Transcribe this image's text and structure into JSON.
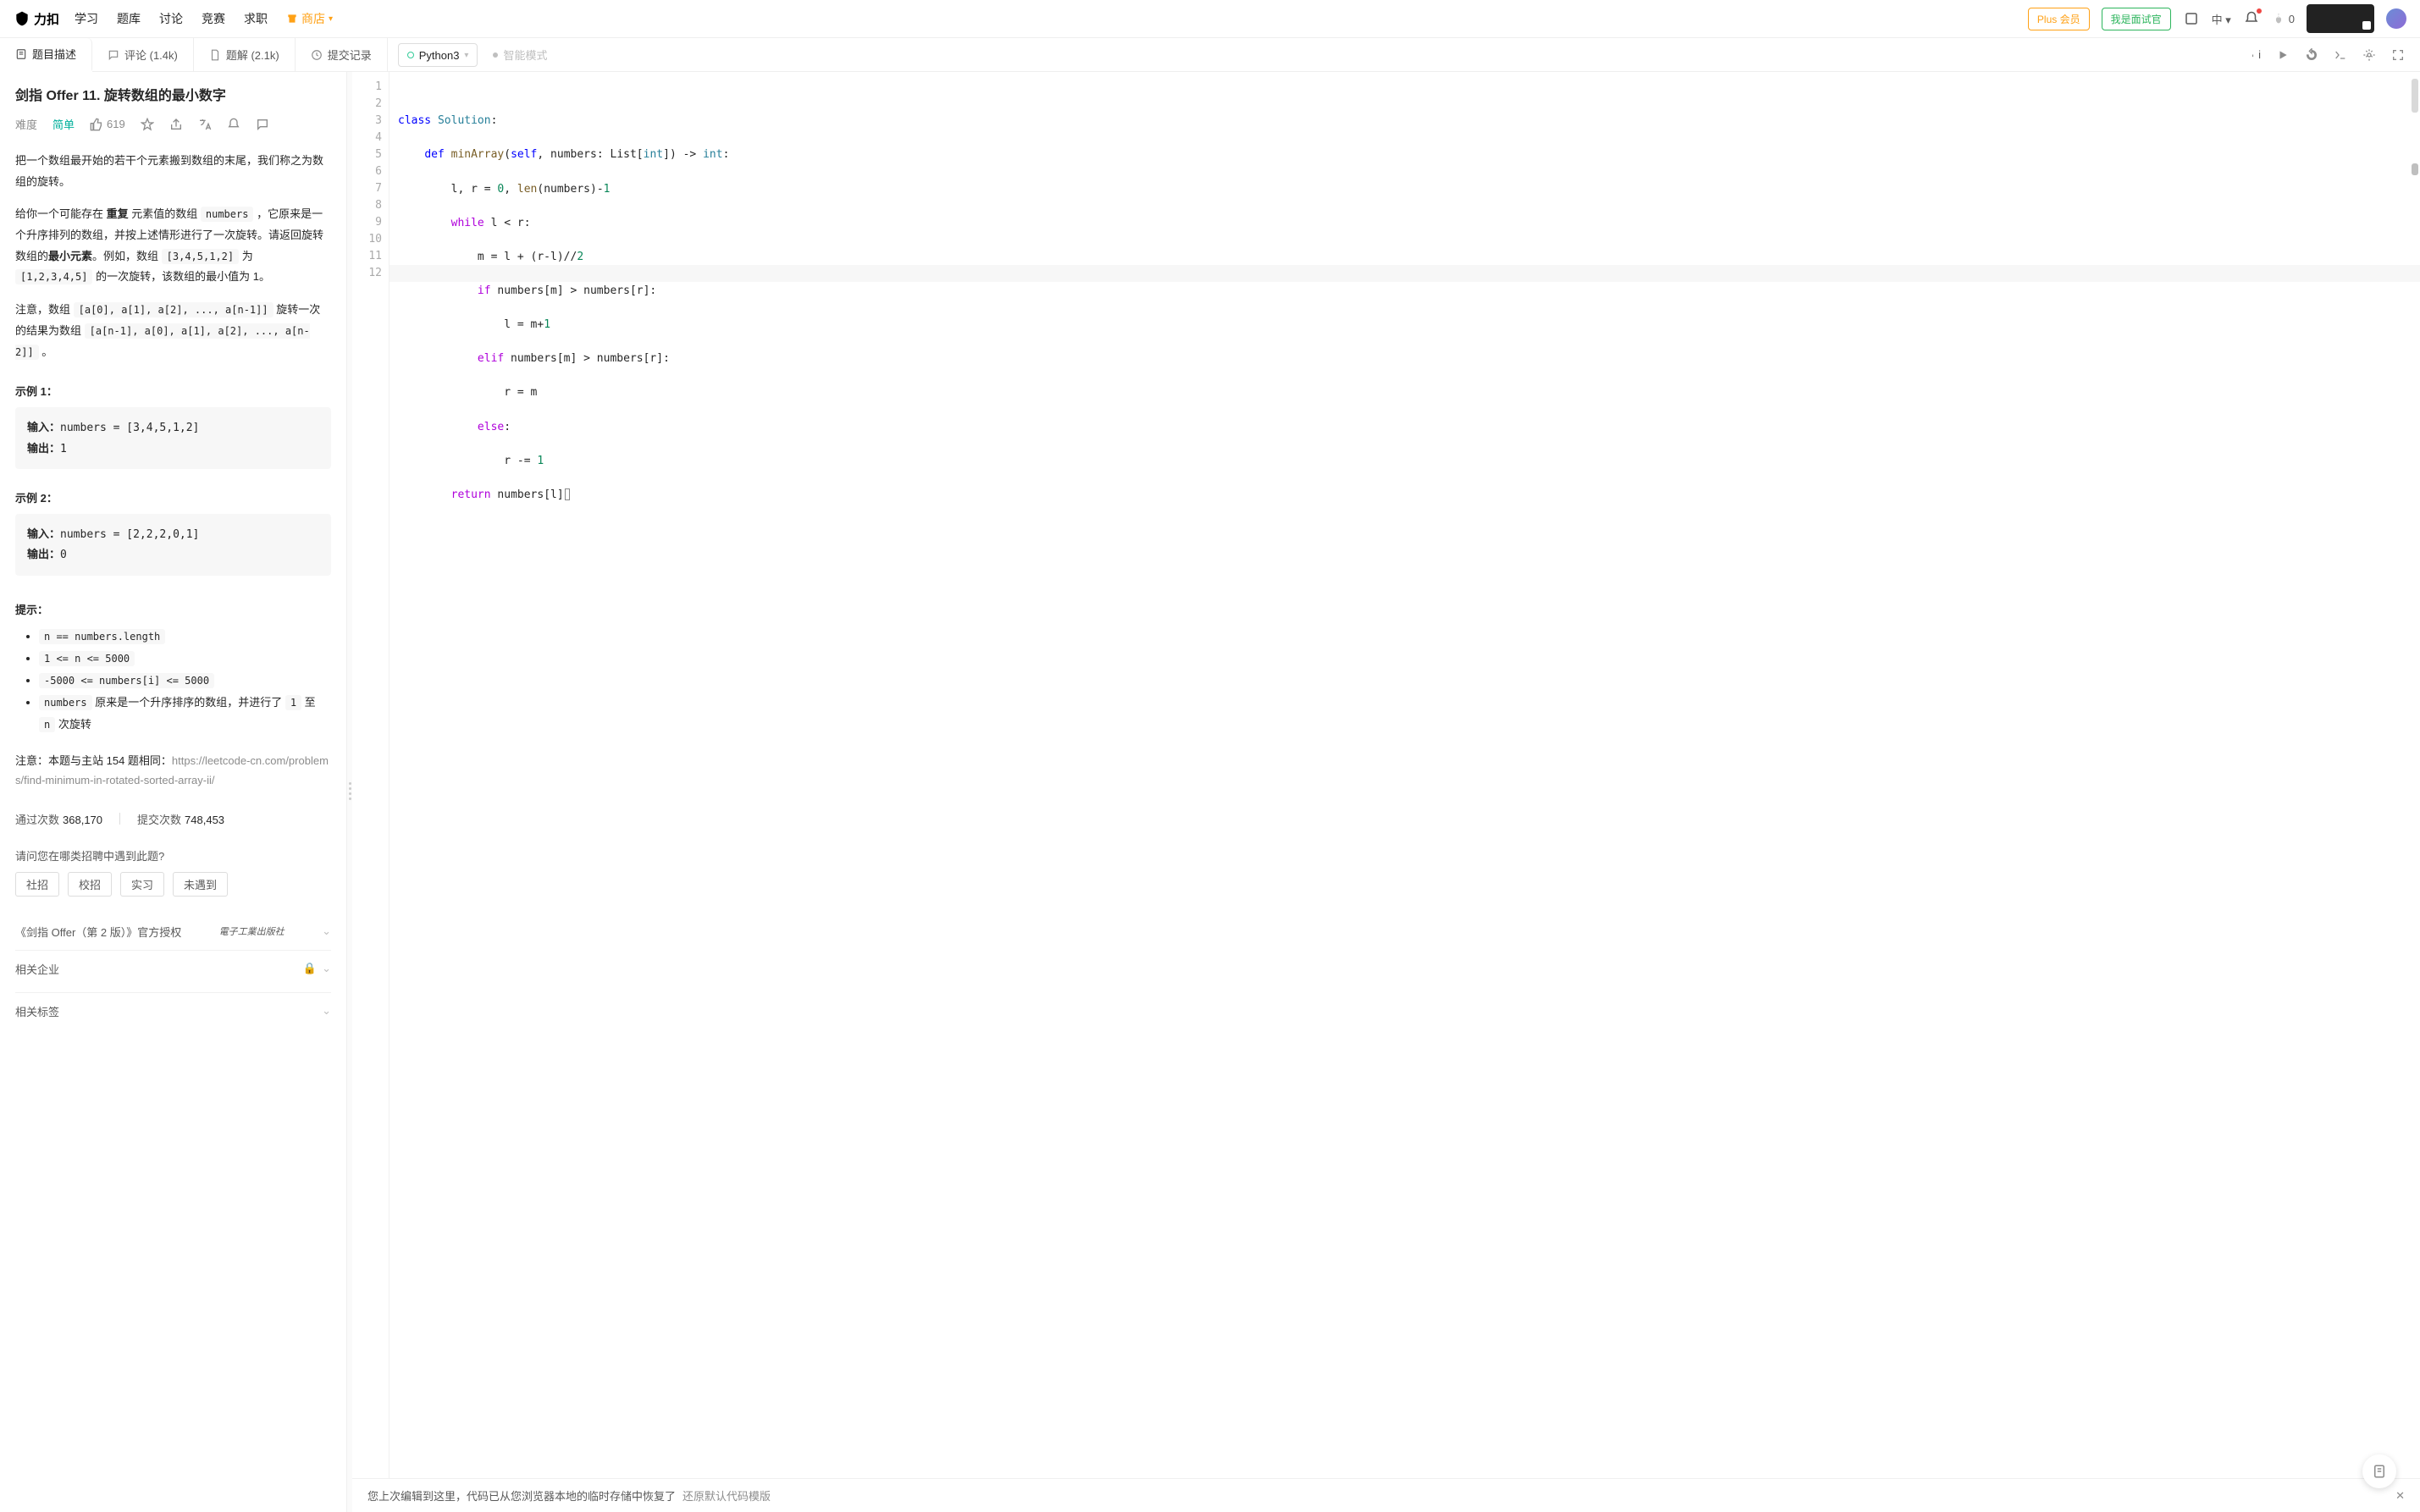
{
  "nav": {
    "logo": "力扣",
    "items": [
      "学习",
      "题库",
      "讨论",
      "竞赛",
      "求职"
    ],
    "store": "商店",
    "plus": "Plus 会员",
    "interviewer": "我是面试官",
    "lang_switch": "中",
    "fire_count": "0"
  },
  "tabs": {
    "desc": "题目描述",
    "comments": "评论 (1.4k)",
    "solutions": "题解 (2.1k)",
    "submissions": "提交记录"
  },
  "editor_header": {
    "language": "Python3",
    "smart_mode": "智能模式"
  },
  "problem": {
    "title": "剑指 Offer 11. 旋转数组的最小数字",
    "difficulty_label": "难度",
    "difficulty": "简单",
    "likes": "619",
    "desc_p1": "把一个数组最开始的若干个元素搬到数组的末尾，我们称之为数组的旋转。",
    "desc_p2a": "给你一个可能存在 ",
    "desc_p2_bold": "重复",
    "desc_p2b": " 元素值的数组 ",
    "desc_p2_code": "numbers",
    "desc_p2c": " ，它原来是一个升序排列的数组，并按上述情形进行了一次旋转。请返回旋转数组的",
    "desc_p2_bold2": "最小元素",
    "desc_p2d": "。例如，数组 ",
    "desc_p2_code2": "[3,4,5,1,2]",
    "desc_p2e": " 为 ",
    "desc_p2_code3": "[1,2,3,4,5]",
    "desc_p2f": " 的一次旋转，该数组的最小值为 1。",
    "desc_p3a": "注意，数组 ",
    "desc_p3_code1": "[a[0], a[1], a[2], ..., a[n-1]]",
    "desc_p3b": " 旋转一次 的结果为数组 ",
    "desc_p3_code2": "[a[n-1], a[0], a[1], a[2], ..., a[n-2]]",
    "desc_p3c": " 。",
    "example1_title": "示例 1：",
    "example1_input_label": "输入：",
    "example1_input": "numbers = [3,4,5,1,2]",
    "example1_output_label": "输出：",
    "example1_output": "1",
    "example2_title": "示例 2：",
    "example2_input_label": "输入：",
    "example2_input": "numbers = [2,2,2,0,1]",
    "example2_output_label": "输出：",
    "example2_output": "0",
    "hints_title": "提示：",
    "hints": [
      "n == numbers.length",
      "1 <= n <= 5000",
      "-5000 <= numbers[i] <= 5000"
    ],
    "hint_extra_a": "numbers",
    "hint_extra_b": " 原来是一个升序排序的数组，并进行了 ",
    "hint_extra_c": "1",
    "hint_extra_d": " 至 ",
    "hint_extra_e": "n",
    "hint_extra_f": " 次旋转",
    "note_prefix": "注意：本题与主站 154 题相同：",
    "note_link": "https://leetcode-cn.com/problems/find-minimum-in-rotated-sorted-array-ii/",
    "stats_pass_label": "通过次数",
    "stats_pass": "368,170",
    "stats_submit_label": "提交次数",
    "stats_submit": "748,453",
    "encounter_q": "请问您在哪类招聘中遇到此题?",
    "chips": [
      "社招",
      "校招",
      "实习",
      "未遇到"
    ],
    "book": "《剑指 Offer（第 2 版）》官方授权",
    "book_publisher": "電子工業出版社",
    "related_company": "相关企业",
    "related_tags": "相关标签"
  },
  "code": {
    "lines": [
      {
        "n": 1,
        "raw": "class Solution:"
      },
      {
        "n": 2,
        "raw": "    def minArray(self, numbers: List[int]) -> int:"
      },
      {
        "n": 3,
        "raw": "        l, r = 0, len(numbers)-1"
      },
      {
        "n": 4,
        "raw": "        while l < r:"
      },
      {
        "n": 5,
        "raw": "            m = l + (r-l)//2"
      },
      {
        "n": 6,
        "raw": "            if numbers[m] > numbers[r]:"
      },
      {
        "n": 7,
        "raw": "                l = m+1"
      },
      {
        "n": 8,
        "raw": "            elif numbers[m] > numbers[r]:"
      },
      {
        "n": 9,
        "raw": "                r = m"
      },
      {
        "n": 10,
        "raw": "            else:"
      },
      {
        "n": 11,
        "raw": "                r -= 1"
      },
      {
        "n": 12,
        "raw": "        return numbers[l]"
      }
    ]
  },
  "notice": {
    "text": "您上次编辑到这里，代码已从您浏览器本地的临时存储中恢复了",
    "restore": "还原默认代码模版"
  }
}
